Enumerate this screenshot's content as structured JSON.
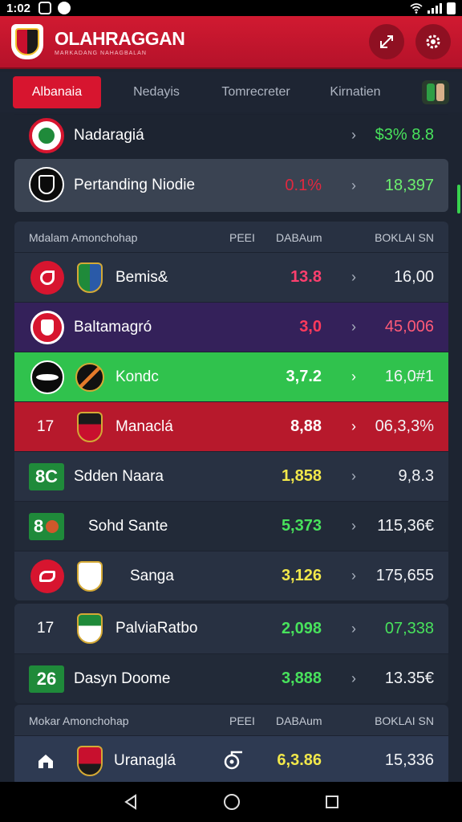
{
  "status_bar": {
    "time": "1:02"
  },
  "header": {
    "title": "OLAHRAGGAN",
    "tagline": "MARKADANG NAHAGBALAN"
  },
  "tabs": [
    {
      "label": "Albanaia",
      "active": true
    },
    {
      "label": "Nedayis"
    },
    {
      "label": "Tomrecreter"
    },
    {
      "label": "Kirnatien"
    }
  ],
  "featured": [
    {
      "name": "Nadaragiá",
      "value": "$3% 8.8"
    },
    {
      "name": "Pertanding Niodie",
      "pct": "0.1%",
      "value": "18,397"
    }
  ],
  "table_header": {
    "title": "Mdalam Amonchohap",
    "c1": "PEEI",
    "c2": "DABAum",
    "c3": "BOKLAI SN"
  },
  "group_a": [
    {
      "name": "Bemis&",
      "v1": "13.8",
      "v2": "16,00",
      "v1_color": "#ff3f6e",
      "bg": "#283142"
    },
    {
      "name": "Baltamagró",
      "v1": "3,0",
      "v2": "45,006",
      "v1_color": "#ff3a5c",
      "v2_color": "#ff5a78",
      "bg": "#34215a"
    },
    {
      "name": "Kondc",
      "v1": "3,7.2",
      "v2": "16,0#1",
      "v1_color": "#ffffff",
      "bg": "#30c24d"
    },
    {
      "rank": "17",
      "name": "Manaclá",
      "v1": "8,88",
      "v2": "06,3,3%",
      "v1_color": "#ffffff",
      "bg": "#b7192c"
    },
    {
      "badge": "8C",
      "name": "Sdden Naara",
      "v1": "1,858",
      "v2": "9,8.3",
      "v1_color": "#f2e84a",
      "bg": "#283142"
    },
    {
      "badge": "8",
      "name": "Sohd Sante",
      "v1": "5,373",
      "v2": "115,36€",
      "v1_color": "#48e25c",
      "bg": "#222a38"
    },
    {
      "name": "Sanga",
      "v1": "3,126",
      "v2": "175,655",
      "v1_color": "#f2e84a",
      "bg": "#283142"
    }
  ],
  "group_b": [
    {
      "rank": "17",
      "name": "PalviaRatbo",
      "v1": "2,098",
      "v2": "07,338",
      "v1_color": "#48e25c",
      "v2_color": "#48e25c",
      "bg": "#283142"
    },
    {
      "badge": "26",
      "name": "Dasyn Doome",
      "v1": "3,888",
      "v2": "13.35€",
      "v1_color": "#48e25c",
      "bg": "#222a38"
    }
  ],
  "table_header_2": {
    "title": "Mokar Amonchohap",
    "c1": "PEEI",
    "c2": "DABAum",
    "c3": "BOKLAI SN"
  },
  "bottom_row": {
    "name": "Uranaglá",
    "v1": "6,3.86",
    "v2": "15,336",
    "v1_color": "#f2e84a"
  },
  "colors": {
    "accent": "#d7152f",
    "panel": "#283142",
    "bg": "#1d2431",
    "green": "#30c24d"
  }
}
